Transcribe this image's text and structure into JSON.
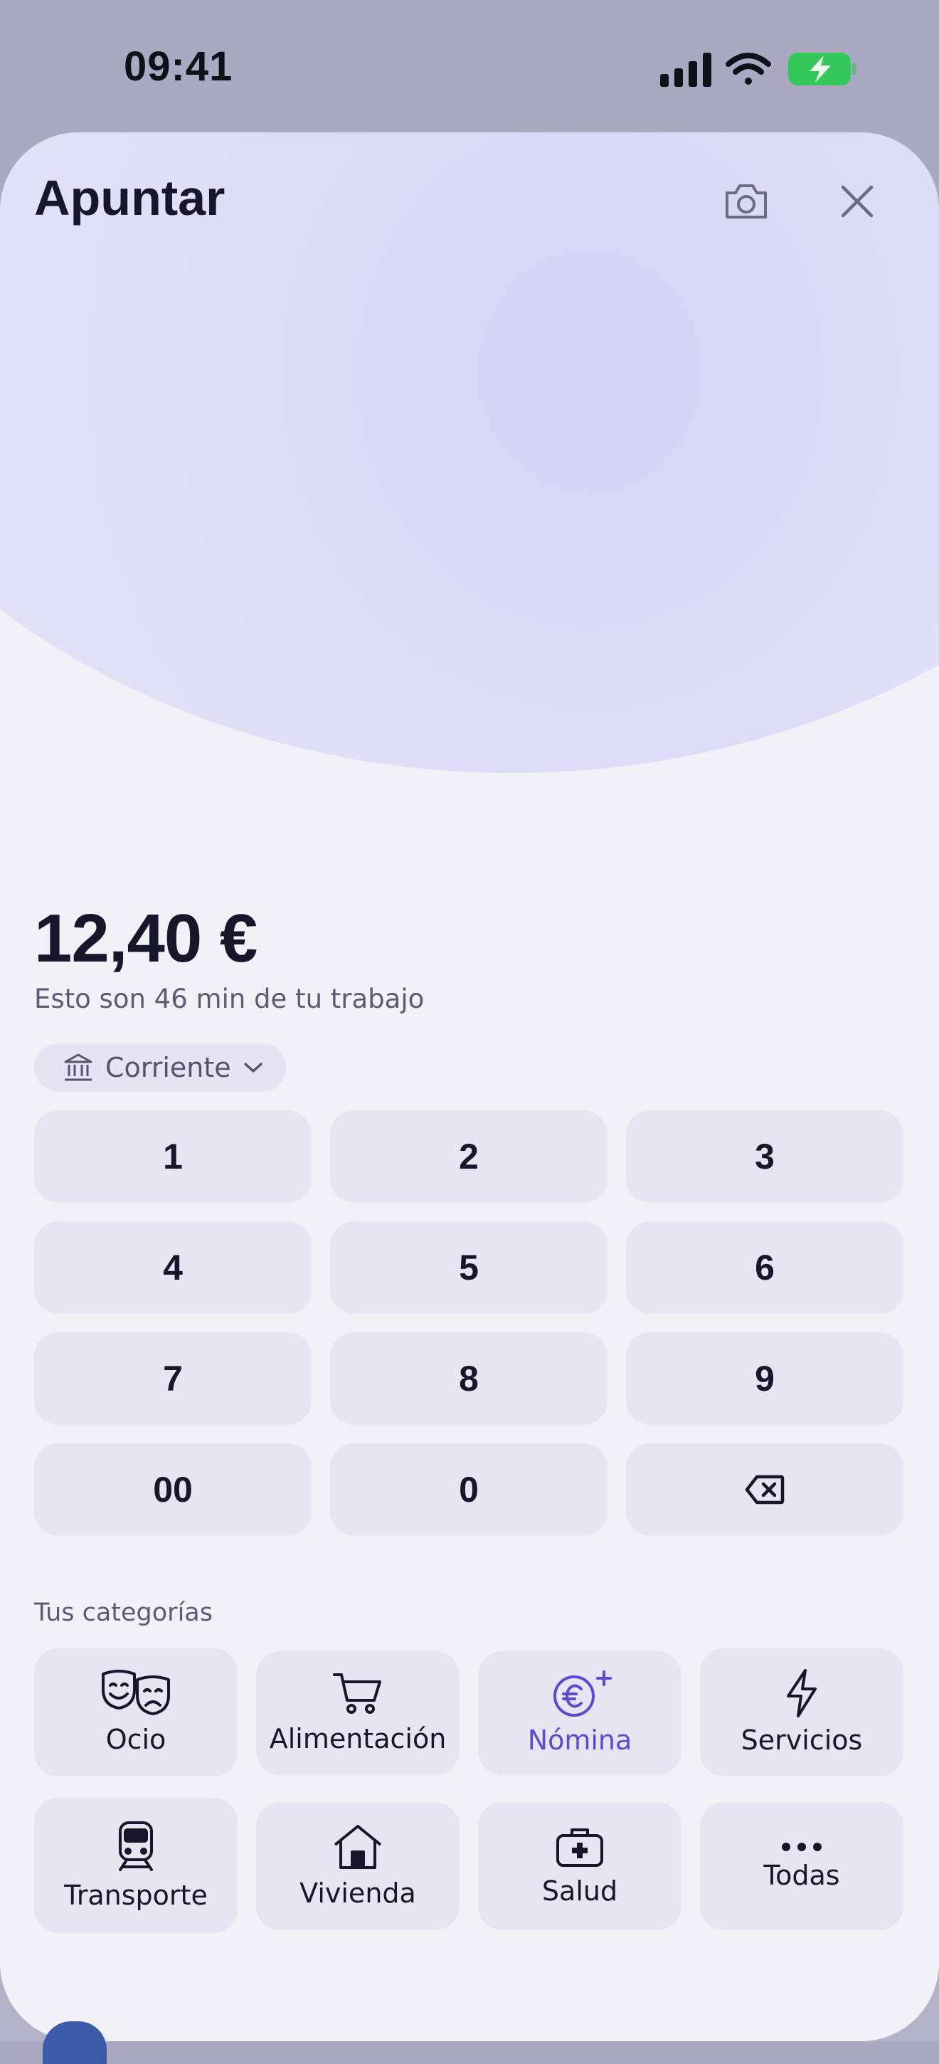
{
  "status_bar": {
    "time": "09:41"
  },
  "sheet": {
    "title": "Apuntar",
    "amount": "12,40 €",
    "work_note": "Esto son 46 min de tu trabajo",
    "account": {
      "label": "Corriente"
    }
  },
  "keypad": {
    "keys": [
      "1",
      "2",
      "3",
      "4",
      "5",
      "6",
      "7",
      "8",
      "9",
      "00",
      "0"
    ]
  },
  "categories": {
    "heading": "Tus categorías",
    "items": [
      {
        "label": "Ocio",
        "icon": "theater-masks-icon"
      },
      {
        "label": "Alimentación",
        "icon": "cart-icon"
      },
      {
        "label": "Nómina",
        "icon": "euro-plus-icon",
        "active": true
      },
      {
        "label": "Servicios",
        "icon": "lightning-icon"
      },
      {
        "label": "Transporte",
        "icon": "train-icon"
      },
      {
        "label": "Vivienda",
        "icon": "house-icon"
      },
      {
        "label": "Salud",
        "icon": "first-aid-kit-icon"
      },
      {
        "label": "Todas",
        "icon": "more-dots-icon"
      }
    ]
  },
  "colors": {
    "accent": "#5b4bd1",
    "battery": "#34c759",
    "key_bg": "#e7e5f1"
  }
}
